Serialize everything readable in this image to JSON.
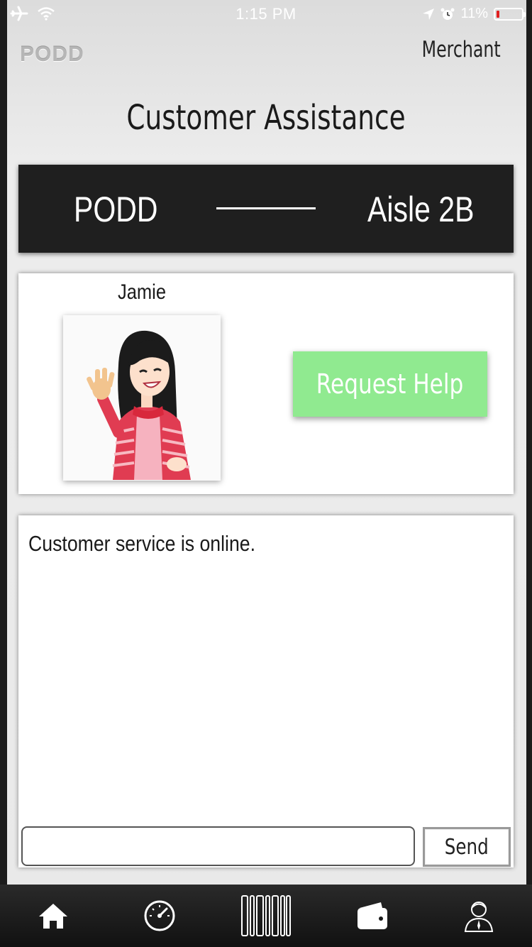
{
  "status_bar": {
    "time": "1:15 PM",
    "battery_percent": "11%",
    "battery_level": 0.11
  },
  "header": {
    "logo": "PODD",
    "merchant_link": "Merchant",
    "title": "Customer Assistance"
  },
  "route": {
    "from": "PODD",
    "to": "Aisle 2B"
  },
  "agent": {
    "name": "Jamie",
    "request_help_label": "Request Help"
  },
  "chat": {
    "messages": [
      "Customer service is online."
    ],
    "input_value": "",
    "send_label": "Send"
  },
  "tabbar": {
    "items": [
      "home-icon",
      "speedometer-icon",
      "barcode-icon",
      "wallet-icon",
      "profile-icon"
    ]
  },
  "colors": {
    "accent_green": "#90ea90",
    "dark_bar": "#1f1f1f",
    "battery_low": "#e02020"
  }
}
